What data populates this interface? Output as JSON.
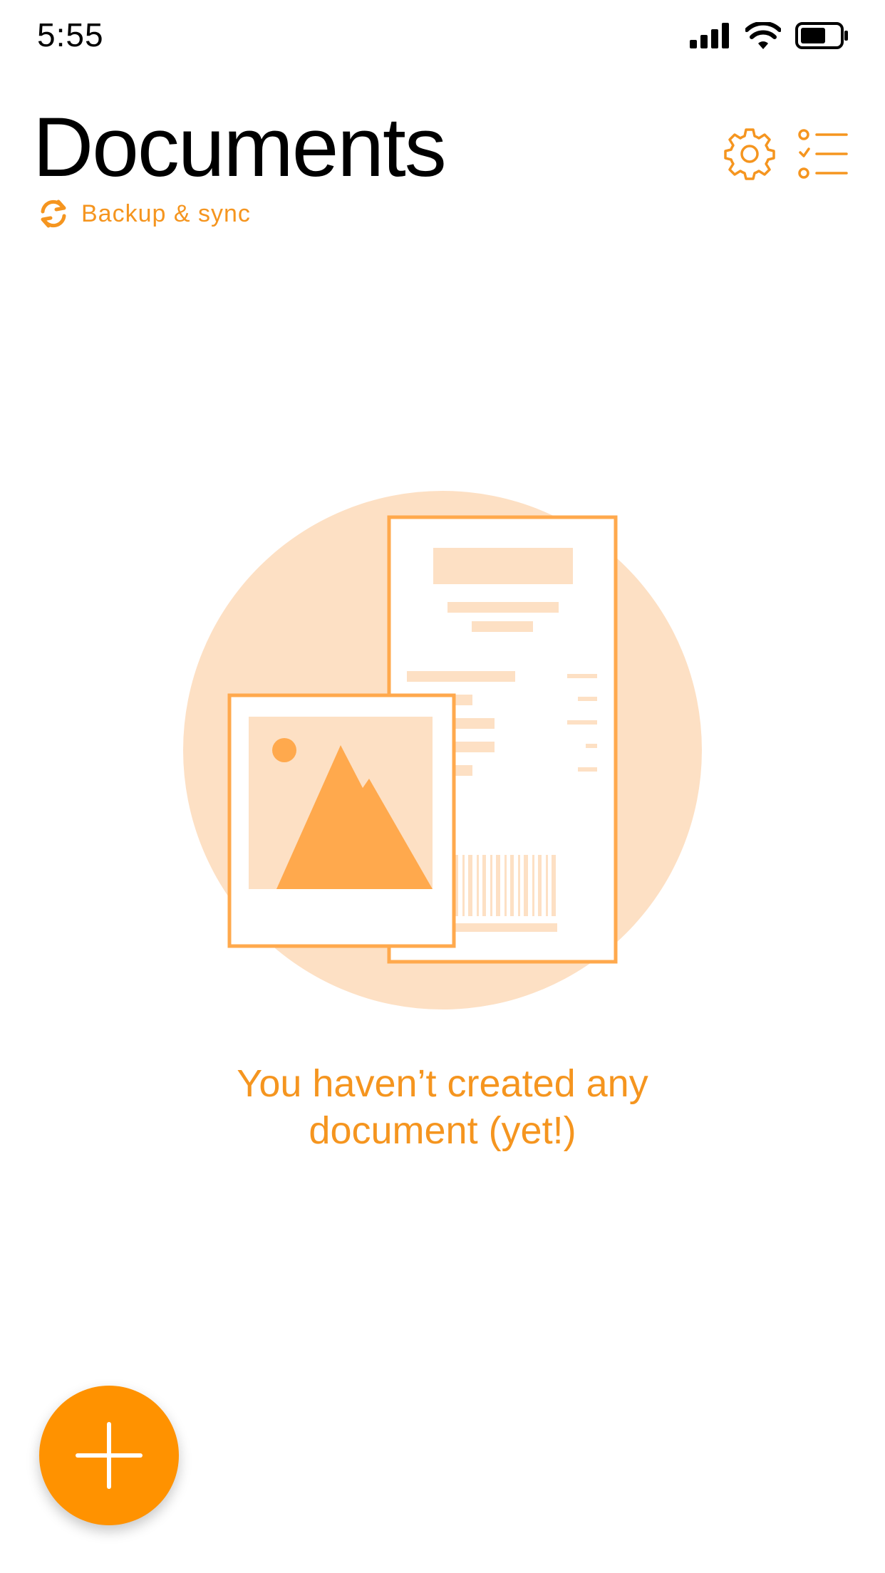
{
  "status_bar": {
    "time": "5:55",
    "icons": [
      "cellular-signal-icon",
      "wifi-icon",
      "battery-icon"
    ]
  },
  "header": {
    "title": "Documents",
    "sync_label": "Backup & sync",
    "actions": [
      "settings-gear-icon",
      "checklist-icon"
    ]
  },
  "empty_state": {
    "line1": "You haven’t created any",
    "line2": "document (yet!)",
    "illustration": [
      "receipt-document-icon",
      "photo-image-icon"
    ]
  },
  "fab": {
    "icon": "plus-icon"
  },
  "colors": {
    "accent": "#f5951f",
    "fab": "#ff9200",
    "illustration_light": "#fde0c4",
    "illustration_mid": "#ffa94d"
  }
}
